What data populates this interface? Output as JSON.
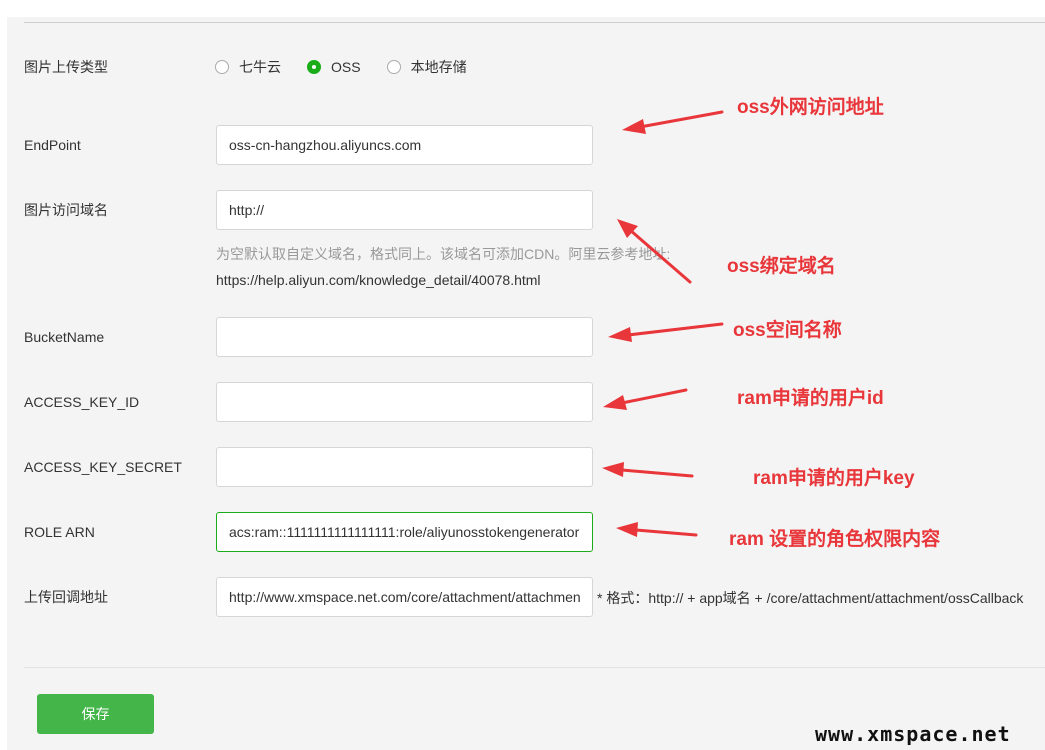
{
  "form": {
    "upload_type": {
      "label": "图片上传类型",
      "options": [
        {
          "label": "七牛云",
          "checked": false
        },
        {
          "label": "OSS",
          "checked": true
        },
        {
          "label": "本地存储",
          "checked": false
        }
      ]
    },
    "endpoint": {
      "label": "EndPoint",
      "value": "oss-cn-hangzhou.aliyuncs.com"
    },
    "domain": {
      "label": "图片访问域名",
      "value": "http://",
      "help_line1": "为空默认取自定义域名，格式同上。该域名可添加CDN。阿里云参考地址:",
      "help_line2": "https://help.aliyun.com/knowledge_detail/40078.html"
    },
    "bucket": {
      "label": "BucketName",
      "value": ""
    },
    "access_key_id": {
      "label": "ACCESS_KEY_ID",
      "value": ""
    },
    "access_key_secret": {
      "label": "ACCESS_KEY_SECRET",
      "value": ""
    },
    "role_arn": {
      "label": "ROLE ARN",
      "value": "acs:ram::1111111111111111:role/aliyunosstokengenerator"
    },
    "callback": {
      "label": "上传回调地址",
      "value": "http://www.xmspace.net.com/core/attachment/attachment/ossCallback",
      "suffix": "* 格式：http:// + app域名 + /core/attachment/attachment/ossCallback"
    },
    "save_label": "保存"
  },
  "annotations": {
    "endpoint": "oss外网访问地址",
    "domain": "oss绑定域名",
    "bucket": "oss空间名称",
    "access_key_id": "ram申请的用户id",
    "access_key_secret": "ram申请的用户key",
    "role_arn": "ram 设置的角色权限内容"
  },
  "colors": {
    "accent_green": "#1aad19",
    "button_green": "#44b549",
    "annotation_red": "#e8363a"
  },
  "watermark": "www.xmspace.net"
}
